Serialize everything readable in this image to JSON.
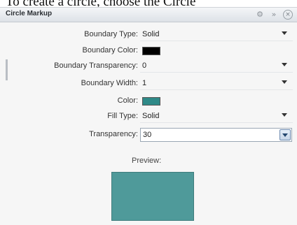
{
  "caption": "To create a circle, choose the Circle",
  "panel": {
    "title": "Circle Markup",
    "icons": [
      "gear-icon",
      "double-chevron-icon",
      "close-icon"
    ]
  },
  "fields": {
    "boundary_type": {
      "label": "Boundary Type:",
      "value": "Solid"
    },
    "boundary_color": {
      "label": "Boundary Color:",
      "color": "#000000"
    },
    "boundary_transparency": {
      "label": "Boundary Transparency:",
      "value": "0"
    },
    "boundary_width": {
      "label": "Boundary Width:",
      "value": "1"
    },
    "color": {
      "label": "Color:",
      "color": "#2f8a88"
    },
    "fill_type": {
      "label": "Fill Type:",
      "value": "Solid"
    },
    "transparency": {
      "label": "Transparency:",
      "value": "30"
    }
  },
  "preview": {
    "label": "Preview:",
    "color": "#4f9a9a"
  }
}
